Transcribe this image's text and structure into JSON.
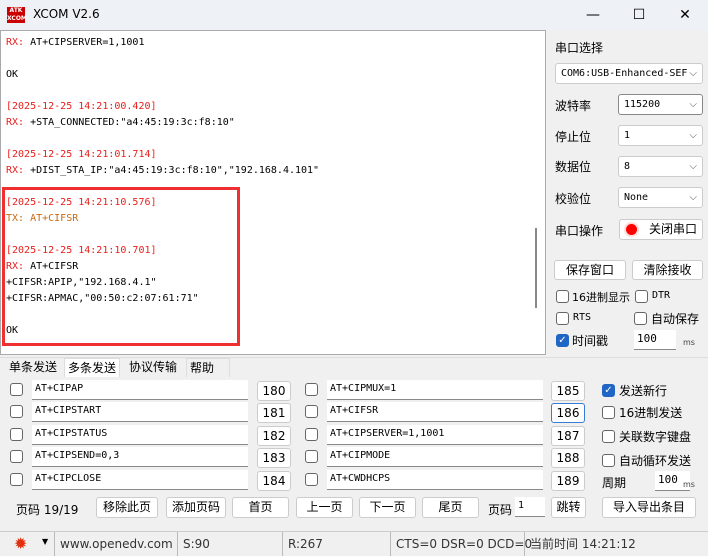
{
  "window": {
    "title": "XCOM V2.6",
    "logo": "ATK XCOM",
    "minimize": "—",
    "maximize": "☐",
    "close": "✕"
  },
  "log": [
    {
      "text": "RX: AT+CIPSERVER=1,1001",
      "kind": "rx"
    },
    {
      "text": "OK",
      "kind": "plain"
    },
    {
      "text": "[2025-12-25 14:21:00.420]",
      "kind": "ts"
    },
    {
      "text": "RX: +STA_CONNECTED:\"a4:45:19:3c:f8:10\"",
      "kind": "rx"
    },
    {
      "text": "[2025-12-25 14:21:01.714]",
      "kind": "ts"
    },
    {
      "text": "RX: +DIST_STA_IP:\"a4:45:19:3c:f8:10\",\"192.168.4.101\"",
      "kind": "rx"
    },
    {
      "text": "[2025-12-25 14:21:10.576]",
      "kind": "ts"
    },
    {
      "text": "TX: AT+CIFSR",
      "kind": "tx"
    },
    {
      "text": "[2025-12-25 14:21:10.701]",
      "kind": "ts"
    },
    {
      "text": "RX: AT+CIFSR",
      "kind": "rx"
    },
    {
      "text": "+CIFSR:APIP,\"192.168.4.1\"",
      "kind": "plain"
    },
    {
      "text": "+CIFSR:APMAC,\"00:50:c2:07:61:71\"",
      "kind": "plain"
    },
    {
      "text": "OK",
      "kind": "plain"
    }
  ],
  "panel": {
    "port_label": "串口选择",
    "port_value": "COM6:USB-Enhanced-SEF",
    "baud_label": "波特率",
    "baud_value": "115200",
    "stop_label": "停止位",
    "stop_value": "1",
    "data_label": "数据位",
    "data_value": "8",
    "parity_label": "校验位",
    "parity_value": "None",
    "op_label": "串口操作",
    "op_button": "关闭串口",
    "save_window": "保存窗口",
    "clear_recv": "清除接收",
    "hex_display": "16进制显示",
    "dtr": "DTR",
    "rts": "RTS",
    "auto_save": "自动保存",
    "timestamp": "时间戳",
    "timestamp_checked": true,
    "timestamp_value": "100",
    "ms": "ms"
  },
  "tabs": [
    "单条发送",
    "多条发送",
    "协议传输",
    "帮助"
  ],
  "active_tab": "多条发送",
  "multi": [
    {
      "cmd": "AT+CIPAP",
      "num": "180"
    },
    {
      "cmd": "AT+CIPSTART",
      "num": "181"
    },
    {
      "cmd": "AT+CIPSTATUS",
      "num": "182"
    },
    {
      "cmd": "AT+CIPSEND=0,3",
      "num": "183"
    },
    {
      "cmd": "AT+CIPCLOSE",
      "num": "184"
    },
    {
      "cmd": "AT+CIPMUX=1",
      "num": "185"
    },
    {
      "cmd": "AT+CIFSR",
      "num": "186"
    },
    {
      "cmd": "AT+CIPSERVER=1,1001",
      "num": "187"
    },
    {
      "cmd": "AT+CIPMODE",
      "num": "188"
    },
    {
      "cmd": "AT+CWDHCPS",
      "num": "189"
    }
  ],
  "options": {
    "send_newline": "发送新行",
    "hex_send": "16进制发送",
    "numpad": "关联数字键盘",
    "auto_loop": "自动循环发送",
    "period_label": "周期",
    "period_value": "100",
    "ms": "ms"
  },
  "pager": {
    "page_label": "页码 19/19",
    "remove": "移除此页",
    "add": "添加页码",
    "first": "首页",
    "prev": "上一页",
    "next": "下一页",
    "last": "尾页",
    "goto_label": "页码",
    "goto_value": "1",
    "jump": "跳转",
    "import_export": "导入导出条目"
  },
  "status": {
    "url": "www.openedv.com",
    "sent": "S:90",
    "recv": "R:267",
    "lines": "CTS=0 DSR=0 DCD=0",
    "time": "当前时间 14:21:12"
  },
  "colors": {
    "timestamp": "#e8201c",
    "tx": "#c86a10",
    "highlight": "#f03030",
    "accent": "#1f66c5"
  }
}
